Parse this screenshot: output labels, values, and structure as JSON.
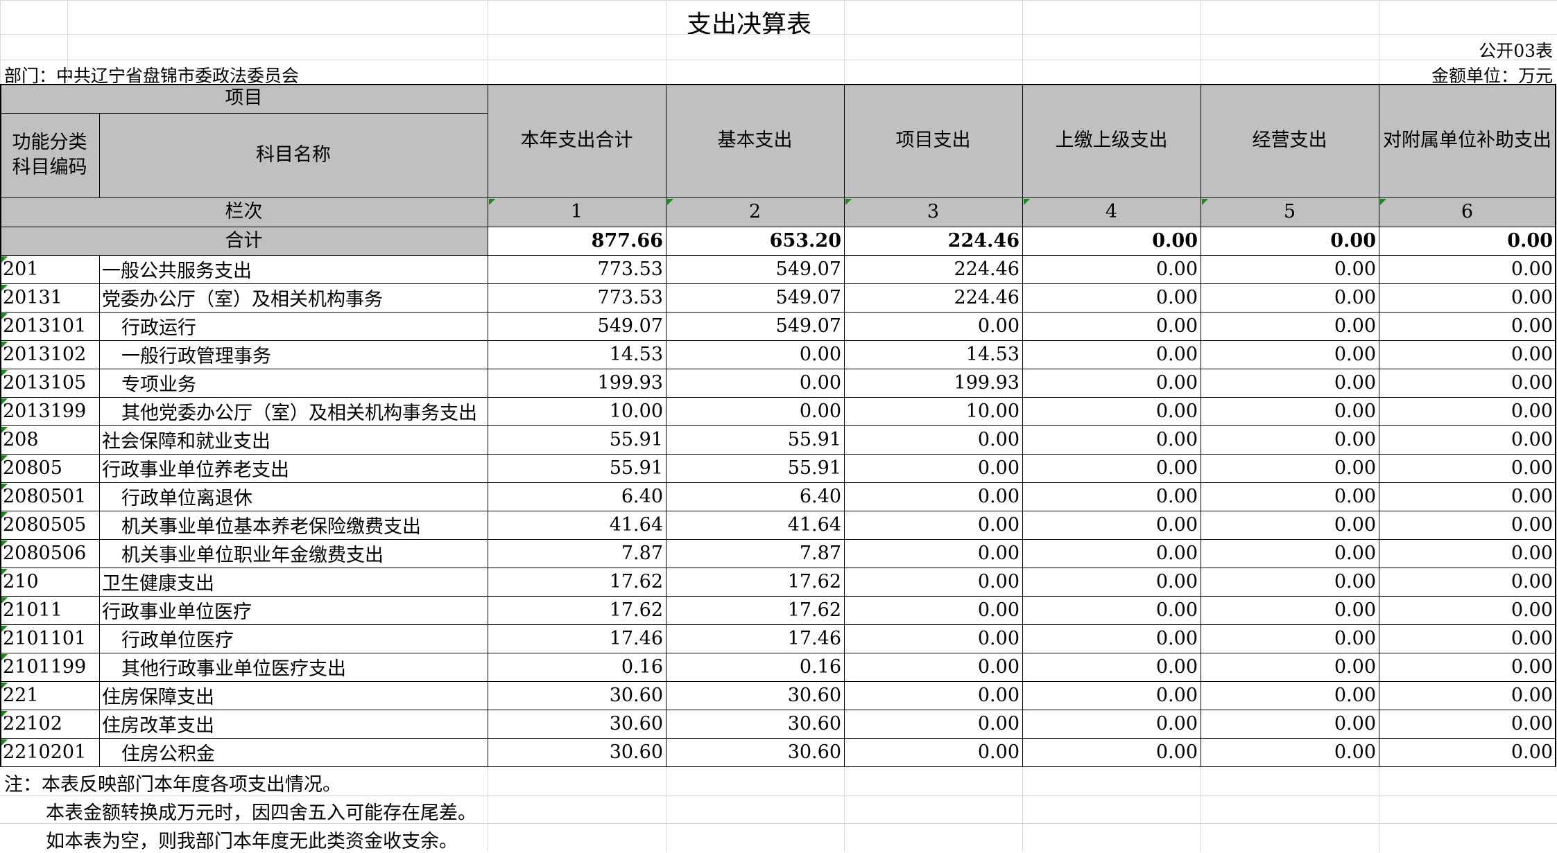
{
  "title": "支出决算表",
  "table_no": "公开03表",
  "department": "部门：中共辽宁省盘锦市委政法委员会",
  "unit": "金额单位：万元",
  "headers": {
    "project": "项目",
    "code": "功能分类\n科目编码",
    "name": "科目名称",
    "cols": [
      "本年支出合计",
      "基本支出",
      "项目支出",
      "上缴上级支出",
      "经营支出",
      "对附属单位补助支出"
    ],
    "lanci": "栏次",
    "col_nums": [
      "1",
      "2",
      "3",
      "4",
      "5",
      "6"
    ]
  },
  "total": {
    "label": "合计",
    "values": [
      "877.66",
      "653.20",
      "224.46",
      "0.00",
      "0.00",
      "0.00"
    ]
  },
  "rows": [
    {
      "code": "201",
      "name": "一般公共服务支出",
      "level": 0,
      "values": [
        "773.53",
        "549.07",
        "224.46",
        "0.00",
        "0.00",
        "0.00"
      ]
    },
    {
      "code": "20131",
      "name": "党委办公厅（室）及相关机构事务",
      "level": 0,
      "values": [
        "773.53",
        "549.07",
        "224.46",
        "0.00",
        "0.00",
        "0.00"
      ]
    },
    {
      "code": "2013101",
      "name": "行政运行",
      "level": 1,
      "values": [
        "549.07",
        "549.07",
        "0.00",
        "0.00",
        "0.00",
        "0.00"
      ]
    },
    {
      "code": "2013102",
      "name": "一般行政管理事务",
      "level": 1,
      "values": [
        "14.53",
        "0.00",
        "14.53",
        "0.00",
        "0.00",
        "0.00"
      ]
    },
    {
      "code": "2013105",
      "name": "专项业务",
      "level": 1,
      "values": [
        "199.93",
        "0.00",
        "199.93",
        "0.00",
        "0.00",
        "0.00"
      ]
    },
    {
      "code": "2013199",
      "name": "其他党委办公厅（室）及相关机构事务支出",
      "level": 1,
      "values": [
        "10.00",
        "0.00",
        "10.00",
        "0.00",
        "0.00",
        "0.00"
      ]
    },
    {
      "code": "208",
      "name": "社会保障和就业支出",
      "level": 0,
      "values": [
        "55.91",
        "55.91",
        "0.00",
        "0.00",
        "0.00",
        "0.00"
      ]
    },
    {
      "code": "20805",
      "name": "行政事业单位养老支出",
      "level": 0,
      "values": [
        "55.91",
        "55.91",
        "0.00",
        "0.00",
        "0.00",
        "0.00"
      ]
    },
    {
      "code": "2080501",
      "name": "行政单位离退休",
      "level": 1,
      "values": [
        "6.40",
        "6.40",
        "0.00",
        "0.00",
        "0.00",
        "0.00"
      ]
    },
    {
      "code": "2080505",
      "name": "机关事业单位基本养老保险缴费支出",
      "level": 1,
      "values": [
        "41.64",
        "41.64",
        "0.00",
        "0.00",
        "0.00",
        "0.00"
      ]
    },
    {
      "code": "2080506",
      "name": "机关事业单位职业年金缴费支出",
      "level": 1,
      "values": [
        "7.87",
        "7.87",
        "0.00",
        "0.00",
        "0.00",
        "0.00"
      ]
    },
    {
      "code": "210",
      "name": "卫生健康支出",
      "level": 0,
      "values": [
        "17.62",
        "17.62",
        "0.00",
        "0.00",
        "0.00",
        "0.00"
      ]
    },
    {
      "code": "21011",
      "name": "行政事业单位医疗",
      "level": 0,
      "values": [
        "17.62",
        "17.62",
        "0.00",
        "0.00",
        "0.00",
        "0.00"
      ]
    },
    {
      "code": "2101101",
      "name": "行政单位医疗",
      "level": 1,
      "values": [
        "17.46",
        "17.46",
        "0.00",
        "0.00",
        "0.00",
        "0.00"
      ]
    },
    {
      "code": "2101199",
      "name": "其他行政事业单位医疗支出",
      "level": 1,
      "values": [
        "0.16",
        "0.16",
        "0.00",
        "0.00",
        "0.00",
        "0.00"
      ]
    },
    {
      "code": "221",
      "name": "住房保障支出",
      "level": 0,
      "values": [
        "30.60",
        "30.60",
        "0.00",
        "0.00",
        "0.00",
        "0.00"
      ]
    },
    {
      "code": "22102",
      "name": "住房改革支出",
      "level": 0,
      "values": [
        "30.60",
        "30.60",
        "0.00",
        "0.00",
        "0.00",
        "0.00"
      ]
    },
    {
      "code": "2210201",
      "name": "住房公积金",
      "level": 1,
      "values": [
        "30.60",
        "30.60",
        "0.00",
        "0.00",
        "0.00",
        "0.00"
      ]
    }
  ],
  "notes": [
    "注：本表反映部门本年度各项支出情况。",
    "本表金额转换成万元时，因四舍五入可能存在尾差。",
    "如本表为空，则我部门本年度无此类资金收支余。"
  ],
  "colors": {
    "header_fill": "#c0c0c0",
    "gridline": "#d9d9d9",
    "marker": "#1a8a1a"
  }
}
